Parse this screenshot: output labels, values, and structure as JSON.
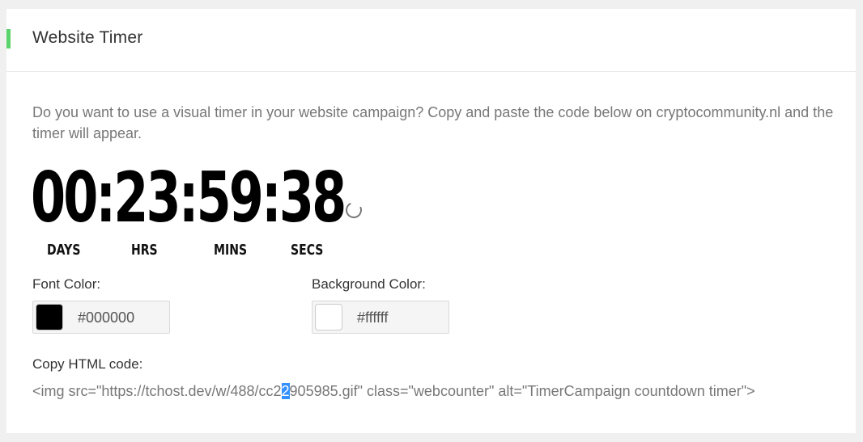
{
  "card": {
    "title": "Website Timer",
    "accent_color": "#5bd36b"
  },
  "intro": {
    "text": "Do you want to use a visual timer in your website campaign? Copy and paste the code below on cryptocommunity.nl and the timer will appear."
  },
  "timer": {
    "display": "00:23:59:38",
    "units": {
      "days": "DAYS",
      "hrs": "HRS",
      "mins": "MINS",
      "secs": "SECS"
    }
  },
  "font_color": {
    "label": "Font Color:",
    "value": "#000000",
    "swatch": "#000000"
  },
  "background_color": {
    "label": "Background Color:",
    "value": "#ffffff",
    "swatch": "#ffffff"
  },
  "html_code": {
    "label": "Copy HTML code:",
    "before_selection": "<img src=\"https://tchost.dev/w/488/cc2",
    "selection": "2",
    "after_selection": "905985.gif\" class=\"webcounter\" alt=\"TimerCampaign countdown timer\">"
  }
}
